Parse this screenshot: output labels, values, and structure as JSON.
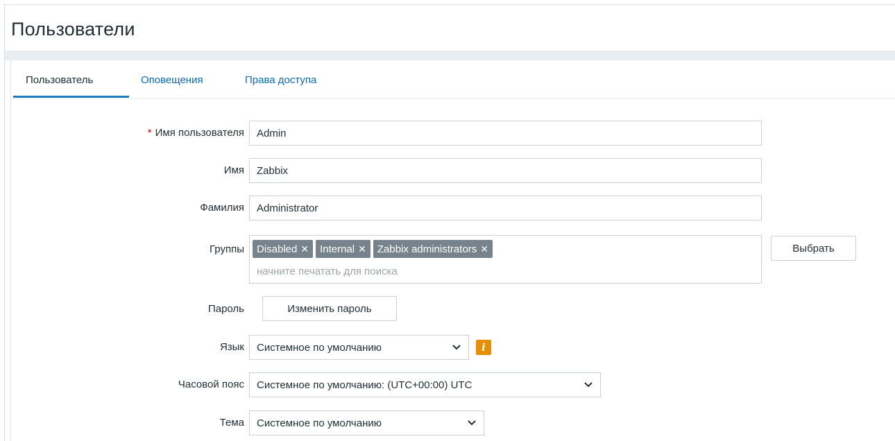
{
  "page": {
    "title": "Пользователи"
  },
  "tabs": [
    {
      "label": "Пользователь",
      "active": true
    },
    {
      "label": "Оповещения",
      "active": false
    },
    {
      "label": "Права доступа",
      "active": false
    }
  ],
  "form": {
    "username": {
      "label": "Имя пользователя",
      "required": true,
      "value": "Admin"
    },
    "name": {
      "label": "Имя",
      "value": "Zabbix"
    },
    "surname": {
      "label": "Фамилия",
      "value": "Administrator"
    },
    "groups": {
      "label": "Группы",
      "items": [
        "Disabled",
        "Internal",
        "Zabbix administrators"
      ],
      "placeholder": "начните печатать для поиска",
      "select_label": "Выбрать"
    },
    "password": {
      "label": "Пароль",
      "button_label": "Изменить пароль"
    },
    "language": {
      "label": "Язык",
      "value": "Системное по умолчанию",
      "info_icon": "info-icon"
    },
    "timezone": {
      "label": "Часовой пояс",
      "value": "Системное по умолчанию: (UTC+00:00) UTC"
    },
    "theme": {
      "label": "Тема",
      "value": "Системное по умолчанию"
    }
  },
  "colors": {
    "accent": "#1f7bc1",
    "link": "#0a6cab",
    "chip": "#76838d",
    "required": "#d40000",
    "info": "#e68e00"
  }
}
